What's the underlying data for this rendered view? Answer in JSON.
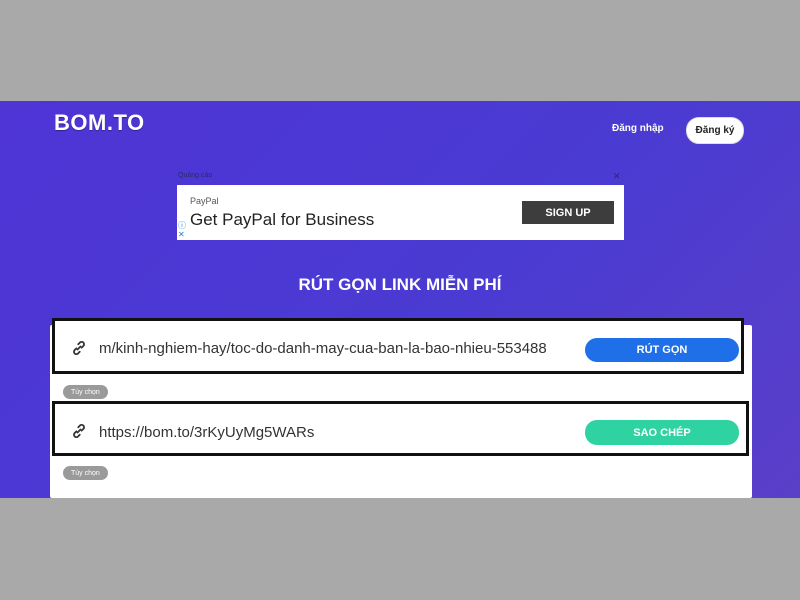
{
  "header": {
    "logo": "BOM.TO",
    "login_label": "Đăng nhập",
    "register_label": "Đăng ký"
  },
  "ad": {
    "label": "Quảng cáo",
    "close": "✕",
    "brand": "PayPal",
    "headline": "Get PayPal for Business",
    "cta": "SIGN UP"
  },
  "main": {
    "title": "RÚT GỌN LINK MIỄN PHÍ",
    "long_url_value": "m/kinh-nghiem-hay/toc-do-danh-may-cua-ban-la-bao-nhieu-553488",
    "shorten_button": "RÚT GỌN",
    "options_label_1": "Tùy chọn",
    "short_url_value": "https://bom.to/3rKyUyMg5WARs",
    "copy_button": "SAO CHÉP",
    "options_label_2": "Tùy chọn"
  },
  "icons": {
    "row_icon": "link-icon",
    "ad_choices": "adchoices-icon"
  },
  "colors": {
    "background_gradient_start": "#4f34d6",
    "shorten_button": "#1e6fe8",
    "copy_button": "#2fd3a2",
    "ad_cta": "#3d3d3d"
  }
}
